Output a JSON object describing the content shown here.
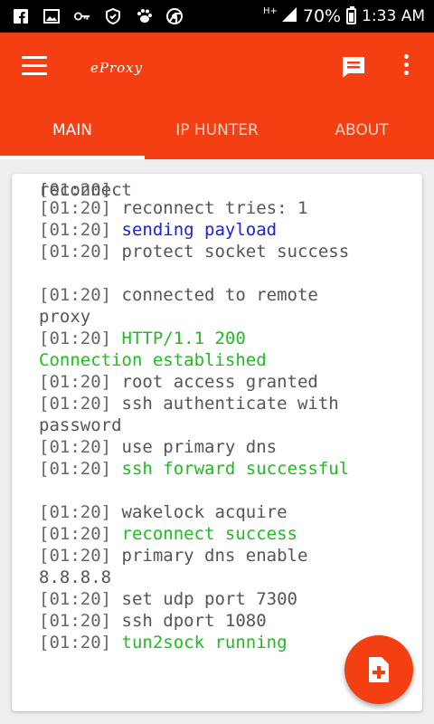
{
  "statusbar": {
    "network": "H+",
    "battery": "70%",
    "time": "1:33 AM",
    "icons": [
      "facebook-icon",
      "image-icon",
      "key-icon",
      "shield-icon",
      "paw-icon",
      "chrome-icon"
    ],
    "battery_level": 0.7
  },
  "toolbar": {
    "title": "eProxy"
  },
  "tabs": [
    {
      "label": "MAIN",
      "active": true
    },
    {
      "label": "IP HUNTER",
      "active": false
    },
    {
      "label": "ABOUT",
      "active": false
    }
  ],
  "log": [
    {
      "ts": "[01:20]",
      "msg": "ssh try reconnect",
      "color": "dark",
      "cut": true
    },
    {
      "ts": "[01:20]",
      "msg": "reconnect tries: 1",
      "color": "dark"
    },
    {
      "ts": "[01:20]",
      "msg": "sending payload",
      "color": "blue"
    },
    {
      "ts": "[01:20]",
      "msg": "protect socket success",
      "color": "dark"
    },
    {
      "blank": true
    },
    {
      "ts": "[01:20]",
      "msg": "connected to remote\nproxy",
      "color": "dark"
    },
    {
      "ts": "[01:20]",
      "msg": "HTTP/1.1 200\nConnection established",
      "color": "green"
    },
    {
      "ts": "[01:20]",
      "msg": "root access granted",
      "color": "dark"
    },
    {
      "ts": "[01:20]",
      "msg": "ssh authenticate with\npassword",
      "color": "dark"
    },
    {
      "ts": "[01:20]",
      "msg": "use primary dns",
      "color": "dark"
    },
    {
      "ts": "[01:20]",
      "msg": "ssh forward successful",
      "color": "green"
    },
    {
      "blank": true
    },
    {
      "ts": "[01:20]",
      "msg": "wakelock acquire",
      "color": "dark"
    },
    {
      "ts": "[01:20]",
      "msg": "reconnect success",
      "color": "green"
    },
    {
      "ts": "[01:20]",
      "msg": "primary dns enable\n8.8.8.8",
      "color": "dark"
    },
    {
      "ts": "[01:20]",
      "msg": "set udp port 7300",
      "color": "dark"
    },
    {
      "ts": "[01:20]",
      "msg": "ssh dport 1080",
      "color": "dark"
    },
    {
      "ts": "[01:20]",
      "msg": "tun2sock running",
      "color": "green"
    }
  ],
  "colors": {
    "accent": "#f43f13",
    "blue": "#1a22d6",
    "green": "#22bb22",
    "text": "#555555"
  },
  "fab": {
    "icon": "add-file-icon"
  }
}
